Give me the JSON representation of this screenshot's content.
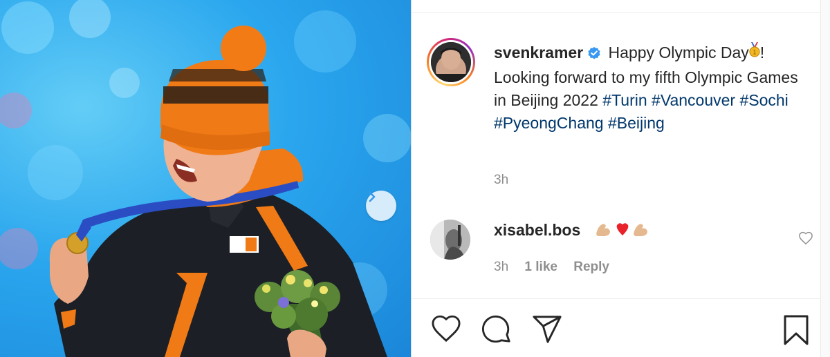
{
  "post": {
    "username": "svenkramer",
    "caption_line1": "Happy Olympic Day",
    "caption_rest": "! Looking forward to my fifth Olympic Games in Beijing 2022 ",
    "hashtags": [
      "#Turin",
      "#Vancouver",
      "#Sochi",
      "#PyeongChang",
      "#Beijing"
    ],
    "time": "3h"
  },
  "comment": {
    "username": "xisabel.bos",
    "time": "3h",
    "likes": "1 like",
    "reply": "Reply"
  },
  "icons": {
    "verified": "verified-badge-icon",
    "medal": "gold-medal-emoji",
    "next": "chevron-right-icon",
    "like": "heart-icon",
    "comment": "comment-bubble-icon",
    "share": "paper-plane-icon",
    "save": "bookmark-icon"
  },
  "colors": {
    "hashtag": "#00376b",
    "verified": "#3897f0",
    "muted": "#8e8e8e"
  }
}
